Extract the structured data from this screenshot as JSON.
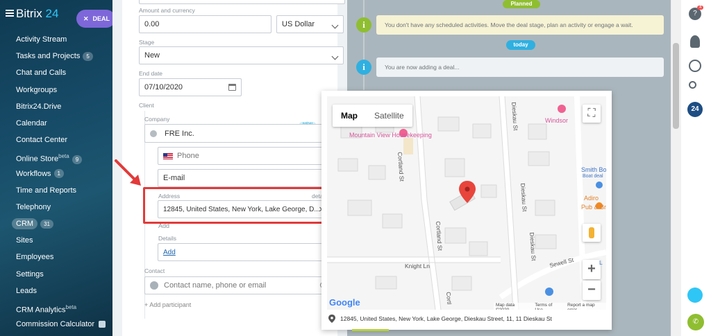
{
  "app": {
    "logo_text": "Bitrix",
    "logo_num": "24",
    "create_button": "DEAL"
  },
  "sidebar": {
    "items": [
      {
        "label": "Activity Stream"
      },
      {
        "label": "Tasks and Projects",
        "badge": "5"
      },
      {
        "label": "Chat and Calls"
      },
      {
        "label": "Workgroups"
      },
      {
        "label": "Bitrix24.Drive"
      },
      {
        "label": "Calendar"
      },
      {
        "label": "Contact Center"
      },
      {
        "label": "Online Store",
        "sup": "beta",
        "badge": "9"
      },
      {
        "label": "Workflows",
        "badge": "1"
      },
      {
        "label": "Time and Reports"
      },
      {
        "label": "Telephony"
      },
      {
        "label": "CRM",
        "badge": "31",
        "active": true
      },
      {
        "label": "Sites"
      },
      {
        "label": "Employees"
      },
      {
        "label": "Settings"
      },
      {
        "label": "Leads"
      },
      {
        "label": "CRM Analytics",
        "sup": "beta"
      },
      {
        "label": "Commission Calculator"
      }
    ]
  },
  "form": {
    "amount_label": "Amount and currency",
    "amount_value": "0.00",
    "currency_value": "US Dollar",
    "stage_label": "Stage",
    "stage_value": "New",
    "end_date_label": "End date",
    "end_date_value": "07/10/2020",
    "client_label": "Client",
    "company_label": "Company",
    "company_value": "FRE Inc.",
    "new_badge": "NEW",
    "phone_placeholder": "Phone",
    "email_placeholder": "E-mail",
    "address_label": "Address",
    "address_detailed": "detailed",
    "address_value": "12845, United States, New York, Lake George, D...",
    "add_label": "Add",
    "details_label": "Details",
    "details_add": "Add",
    "contact_label": "Contact",
    "contact_placeholder": "Contact name, phone or email",
    "add_participant": "+ Add participant"
  },
  "timeline": {
    "planned_pill": "Planned",
    "planned_text": "You don't have any scheduled activities. Move the deal stage, plan an activity or engage a wait.",
    "today_pill": "today",
    "today_text": "You are now adding a deal..."
  },
  "map": {
    "tab_map": "Map",
    "tab_satellite": "Satellite",
    "streets": {
      "cortland_upper": "Cortland St",
      "cortland_lower": "Cortland St",
      "cortland_bottom": "Cortl",
      "dieskau_top": "Dieskau St",
      "dieskau_mid": "Dieskau St",
      "dieskau_low": "Dieskau St",
      "knight": "Knight Ln",
      "sewell": "Sewell St",
      "right_cut": "L"
    },
    "pois": {
      "housekeeping": "Mountain View Housekeeping",
      "windsor": "Windsor",
      "smith": "Smith Bo",
      "smith_sub": "Boat deal",
      "adirondack": "Adiro",
      "adirondack_sub": "Pub & Br"
    },
    "google": "Google",
    "footer": {
      "data": "Map data ©2020",
      "terms": "Terms of Use",
      "report": "Report a map error"
    },
    "address": "12845, United States, New York, Lake George, Dieskau Street, 11, 11 Dieskau St"
  },
  "rail": {
    "help_badge": "4",
    "b24": "24"
  },
  "colors": {
    "accent": "#2fc6f6",
    "highlight": "#e23a3a",
    "timeline_green": "#8fbe31",
    "timeline_blue": "#2fb0e0",
    "deal_button": "#7e67d9"
  }
}
